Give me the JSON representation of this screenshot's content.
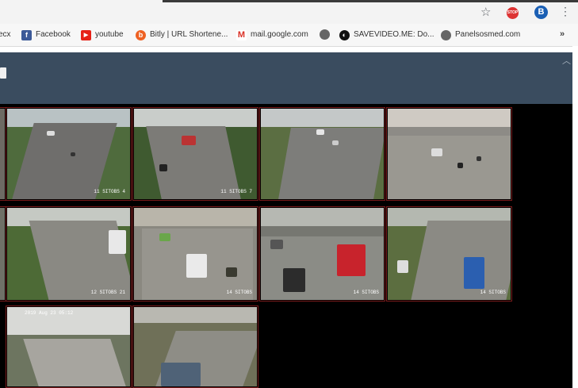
{
  "toolbar": {
    "star_icon": "star-icon",
    "ext_icon_text": "STOP",
    "profile_icon_text": "B",
    "menu_icon": "menu-icon"
  },
  "bookmarks": [
    {
      "label": "ecx",
      "icon": "",
      "color": ""
    },
    {
      "label": "Facebook",
      "icon": "f",
      "color": "#3b5998"
    },
    {
      "label": "youtube",
      "icon": "▶",
      "color": "#e62117"
    },
    {
      "label": "Bitly | URL Shortene...",
      "icon": "b",
      "color": "#ee6123"
    },
    {
      "label": "mail.google.com",
      "icon": "M",
      "color": "#ffffff"
    },
    {
      "label": "",
      "icon": "globe",
      "color": "#666"
    },
    {
      "label": "SAVEVIDEO.ME: Do...",
      "icon": "◐",
      "color": "#111"
    },
    {
      "label": "Panelsosmed.com",
      "icon": "globe",
      "color": "#666"
    }
  ],
  "bookmarks_overflow": "»",
  "cameras": [
    {
      "label": "11 SITOBS 4",
      "stamp": ""
    },
    {
      "label": "11 SITOBS 7",
      "stamp": ""
    },
    {
      "label": "",
      "stamp": ""
    },
    {
      "label": "",
      "stamp": ""
    },
    {
      "label": "12 SITOBS 21",
      "stamp": ""
    },
    {
      "label": "14 SITOBS",
      "stamp": ""
    },
    {
      "label": "14 SITOBS",
      "stamp": ""
    },
    {
      "label": "14 SITOBS",
      "stamp": ""
    },
    {
      "label": "",
      "stamp": "2019 Aug 23 05:12"
    },
    {
      "label": "",
      "stamp": ""
    }
  ]
}
